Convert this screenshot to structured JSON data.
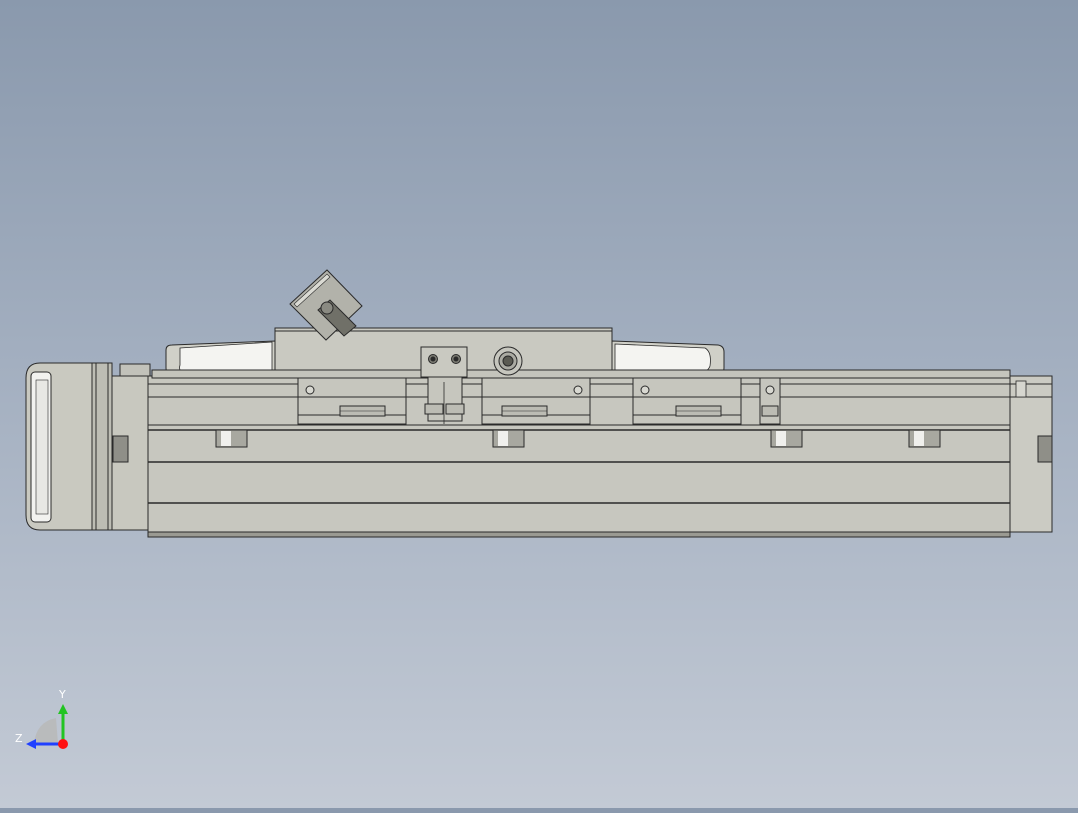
{
  "view": {
    "background_top": "#8a99ad",
    "background_bottom": "#c3cad5",
    "model_face_color": "#c6c6bd",
    "model_edge_color": "#2a2a2a",
    "highlight_color": "#ececea"
  },
  "triad": {
    "axis_y_label": "Y",
    "axis_z_label": "Z",
    "y_color": "#22c422",
    "z_color": "#2040ff",
    "x_color": "#ff1010"
  }
}
